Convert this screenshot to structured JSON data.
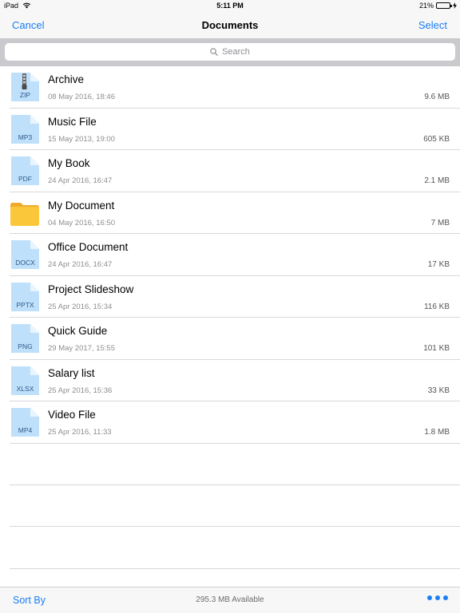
{
  "status": {
    "device": "iPad",
    "time": "5:11 PM",
    "battery": "21%",
    "battery_level": 0.21
  },
  "nav": {
    "cancel_label": "Cancel",
    "title": "Documents",
    "select_label": "Select"
  },
  "search": {
    "placeholder": "Search"
  },
  "files": [
    {
      "name": "Archive",
      "date": "08 May 2016, 18:46",
      "size": "9.6 MB",
      "type": "ZIP",
      "icon": "zip-file-icon"
    },
    {
      "name": "Music File",
      "date": "15 May 2013, 19:00",
      "size": "605 KB",
      "type": "MP3",
      "icon": "mp3-file-icon"
    },
    {
      "name": "My Book",
      "date": "24 Apr 2016, 16:47",
      "size": "2.1 MB",
      "type": "PDF",
      "icon": "pdf-file-icon"
    },
    {
      "name": "My Document",
      "date": "04 May 2016, 16:50",
      "size": "7 MB",
      "type": "",
      "icon": "folder-icon"
    },
    {
      "name": "Office Document",
      "date": "24 Apr 2016, 16:47",
      "size": "17 KB",
      "type": "DOCX",
      "icon": "docx-file-icon"
    },
    {
      "name": "Project Slideshow",
      "date": "25 Apr 2016, 15:34",
      "size": "116 KB",
      "type": "PPTX",
      "icon": "pptx-file-icon"
    },
    {
      "name": "Quick Guide",
      "date": "29 May 2017, 15:55",
      "size": "101 KB",
      "type": "PNG",
      "icon": "png-file-icon"
    },
    {
      "name": "Salary list",
      "date": "25 Apr 2016, 15:36",
      "size": "33 KB",
      "type": "XLSX",
      "icon": "xlsx-file-icon"
    },
    {
      "name": "Video File",
      "date": "25 Apr 2016, 11:33",
      "size": "1.8 MB",
      "type": "MP4",
      "icon": "mp4-file-icon"
    }
  ],
  "toolbar": {
    "sort_label": "Sort By",
    "available": "295.3 MB Available"
  },
  "colors": {
    "accent": "#1a7ef5",
    "file_icon": "#bfe0fb",
    "folder": "#fbc73a"
  }
}
